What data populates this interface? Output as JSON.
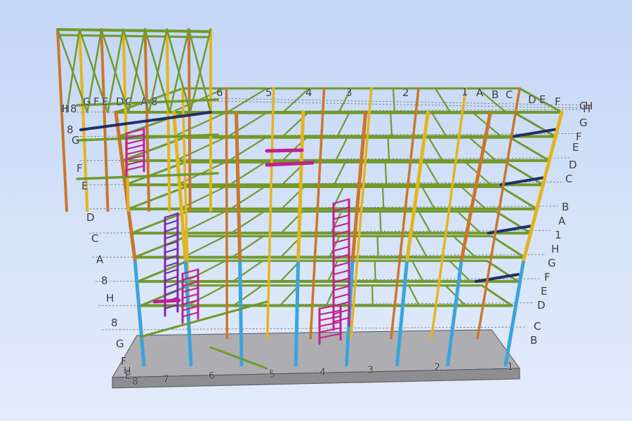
{
  "viewer": {
    "colors": {
      "background_top": "#c3d6f6",
      "background_bottom": "#e4ecfa",
      "beam": "#6f9a2a",
      "beam_dark": "#3f5e12",
      "column_orange": "#c9772a",
      "column_yellow": "#e4b41e",
      "column_cyan": "#3aa4dc",
      "bracing_navy": "#1f2f66",
      "stair_magenta": "#c0208f",
      "slab": "#a7a7ab",
      "gridline": "#6a6a6a"
    },
    "top_grid_labels": [
      "6",
      "5",
      "4",
      "3",
      "2",
      "1",
      "A",
      "B",
      "C",
      "D",
      "E",
      "F",
      "G",
      "H"
    ],
    "left_grid_labels": [
      "H",
      "8",
      "G",
      "F",
      "E",
      "D",
      "C",
      "A",
      "8"
    ],
    "right_grid_labels": [
      "H",
      "G",
      "F",
      "E",
      "D",
      "C",
      "B",
      "A",
      "1"
    ],
    "bottom_grid_labels": [
      "H",
      "8",
      "7",
      "6",
      "5",
      "4",
      "3",
      "2",
      "1"
    ]
  }
}
